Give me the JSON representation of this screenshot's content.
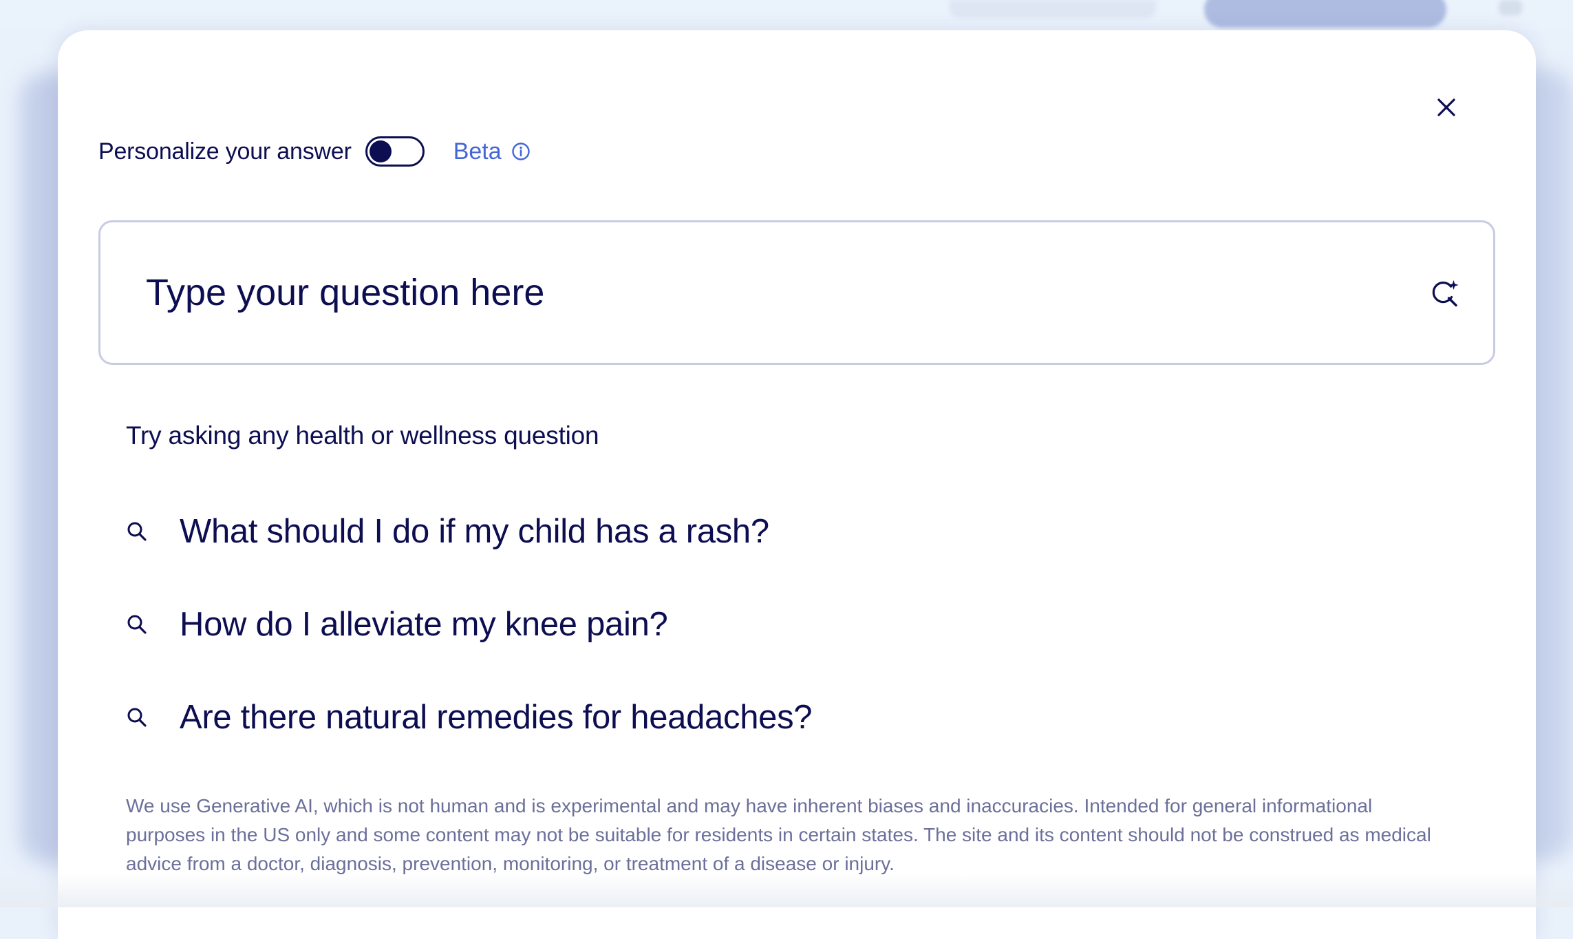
{
  "colors": {
    "navy": "#0d0e52",
    "beta_blue": "#4466d6",
    "border": "#c9cbe3",
    "muted_text": "#6b6f9a",
    "backdrop": "#e9f1fb"
  },
  "modal": {
    "close_icon": "close-icon",
    "personalize": {
      "label": "Personalize your answer",
      "toggle_on": false,
      "beta_label": "Beta",
      "info_icon": "info-icon"
    },
    "search": {
      "placeholder": "Type your question here",
      "value": "",
      "button_icon": "ai-search-sparkle-icon"
    },
    "suggestions_heading": "Try asking any health or wellness question",
    "suggestions": [
      {
        "icon": "search-icon",
        "text": "What should I do if my child has a rash?"
      },
      {
        "icon": "search-icon",
        "text": "How do I alleviate my knee pain?"
      },
      {
        "icon": "search-icon",
        "text": "Are there natural remedies for headaches?"
      }
    ],
    "disclaimer": "We use Generative AI, which is not human and is experimental and may have inherent biases and inaccuracies. Intended for general informational purposes in the US only and some content may not be suitable for residents in certain states. The site and its content should not be construed as medical advice from a doctor, diagnosis, prevention, monitoring, or treatment of a disease or injury."
  }
}
